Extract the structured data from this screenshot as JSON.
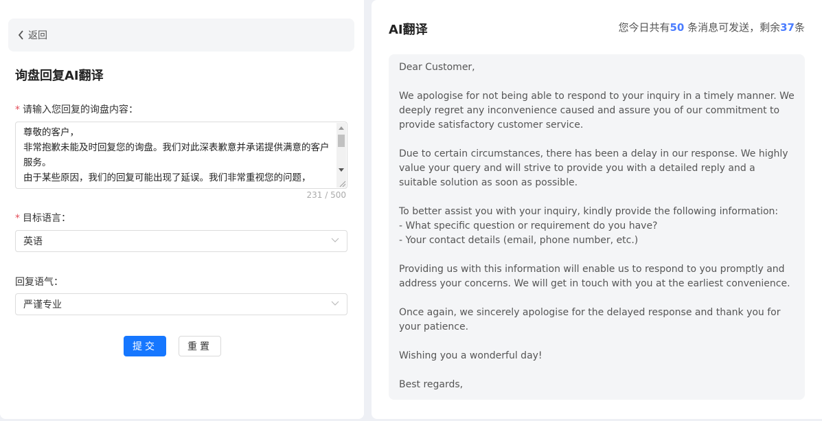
{
  "left": {
    "back_label": "返回",
    "title": "询盘回复AI翻译",
    "inquiry": {
      "required_mark": "*",
      "label": "请输入您回复的询盘内容：",
      "value": "尊敬的客户，\n非常抱歉未能及时回复您的询盘。我们对此深表歉意并承诺提供满意的客户服务。\n由于某些原因，我们的回复可能出现了延误。我们非常重视您的问题，",
      "counter": "231 / 500"
    },
    "language": {
      "required_mark": "*",
      "label": "目标语言：",
      "value": "英语"
    },
    "tone": {
      "label": "回复语气：",
      "value": "严谨专业"
    },
    "submit_label": "提交",
    "reset_label": "重置"
  },
  "right": {
    "title": "AI翻译",
    "quota": {
      "prefix": "您今日共有",
      "total": "50",
      "middle": " 条消息可发送，剩余",
      "remaining": "37",
      "suffix": "条"
    },
    "paragraphs": [
      "Dear Customer,",
      "We apologise for not being able to respond to your inquiry in a timely manner. We deeply regret any inconvenience caused and assure you of our commitment to provide satisfactory customer service.",
      "Due to certain circumstances, there has been a delay in our response. We highly value your query and will strive to provide you with a detailed reply and a suitable solution as soon as possible.",
      "To better assist you with your inquiry, kindly provide the following information:\n- What specific question or requirement do you have?\n- Your contact details (email, phone number, etc.)",
      "Providing us with this information will enable us to respond to you promptly and address your concerns. We will get in touch with you at the earliest convenience.",
      "Once again, we sincerely apologise for the delayed response and thank you for your patience.",
      "Wishing you a wonderful day!",
      "Best regards,"
    ]
  },
  "icons": {
    "back": "chevron-left-icon",
    "select": "chevron-down-icon"
  },
  "colors": {
    "primary": "#1677ff",
    "highlight_number": "#4a7cff",
    "required": "#e34d59"
  }
}
